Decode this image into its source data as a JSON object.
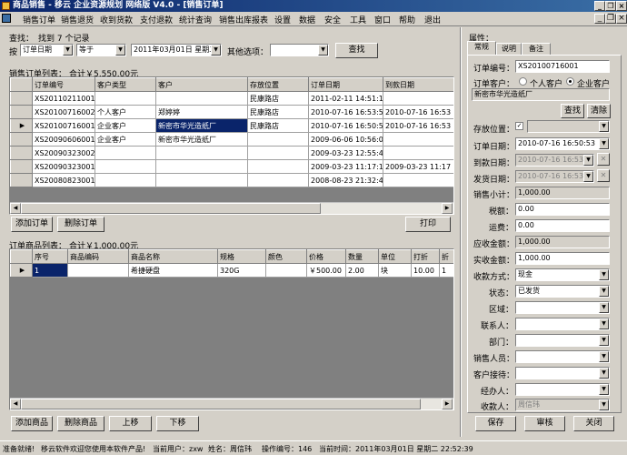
{
  "window": {
    "title": "商品销售 - 移云 企业资源规划 网络版 V4.0 - [销售订单]",
    "minimize": "_",
    "restore": "❐",
    "close": "×"
  },
  "menu": [
    "销售订单",
    "销售退货",
    "收到货款",
    "支付退款",
    "统计查询",
    "销售出库报表",
    "设置",
    "数据",
    "安全",
    "工具",
    "窗口",
    "帮助",
    "退出"
  ],
  "search": {
    "title": "查找：",
    "result": "找到 7 个记录",
    "by_label": "按",
    "field": "订单日期",
    "operator": "等于",
    "date": "2011年03月01日 星期二",
    "other_label": "其他选项：",
    "other_value": "",
    "button": "查找"
  },
  "orders": {
    "caption": "销售订单列表：",
    "total": "合计￥5,550.00元",
    "columns": [
      "订单编号",
      "客户类型",
      "客户",
      "存放位置",
      "订单日期",
      "到款日期"
    ],
    "rows": [
      {
        "marker": "",
        "id": "XS20110211001",
        "type": "",
        "customer": "",
        "location": "民康路店",
        "order_date": "2011-02-11 14:51:18",
        "pay_date": ""
      },
      {
        "marker": "",
        "id": "XS20100716002",
        "type": "个人客户",
        "customer": "郑婷婷",
        "location": "民康路店",
        "order_date": "2010-07-16 16:53:53",
        "pay_date": "2010-07-16 16:53"
      },
      {
        "marker": "▶",
        "id": "XS20100716001",
        "type": "企业客户",
        "customer": "新密市华光造纸厂",
        "location": "民康路店",
        "order_date": "2010-07-16 16:50:53",
        "pay_date": "2010-07-16 16:53"
      },
      {
        "marker": "",
        "id": "XS20090606001",
        "type": "企业客户",
        "customer": "新密市华光造纸厂",
        "location": "",
        "order_date": "2009-06-06 10:56:05",
        "pay_date": ""
      },
      {
        "marker": "",
        "id": "XS20090323002",
        "type": "",
        "customer": "",
        "location": "",
        "order_date": "2009-03-23 12:55:42",
        "pay_date": ""
      },
      {
        "marker": "",
        "id": "XS20090323001",
        "type": "",
        "customer": "",
        "location": "",
        "order_date": "2009-03-23 11:17:16",
        "pay_date": "2009-03-23 11:17"
      },
      {
        "marker": "",
        "id": "XS20080823001",
        "type": "",
        "customer": "",
        "location": "",
        "order_date": "2008-08-23 21:32:40",
        "pay_date": ""
      }
    ],
    "add_button": "添加订单",
    "delete_button": "删除订单",
    "print_button": "打印"
  },
  "items": {
    "caption": "订单商品列表：",
    "total": "合计￥1,000.00元",
    "columns": [
      "序号",
      "商品编码",
      "商品名称",
      "规格",
      "颜色",
      "价格",
      "数量",
      "单位",
      "打折",
      "折"
    ],
    "rows": [
      {
        "marker": "▶",
        "no": "1",
        "code": "",
        "name": "希捷硬盘",
        "spec": "320G",
        "color": "",
        "price": "￥500.00",
        "qty": "2.00",
        "unit": "块",
        "discount": "10.00",
        "extra": "1"
      }
    ],
    "add_button": "添加商品",
    "delete_button": "删除商品",
    "up_button": "上移",
    "down_button": "下移"
  },
  "props": {
    "title": "属性：",
    "tabs": [
      "常规",
      "说明",
      "备注"
    ],
    "order_no_label": "订单编号：",
    "order_no": "XS20100716001",
    "customer_label": "订单客户：",
    "customer_type_personal": "个人客户",
    "customer_type_company": "企业客户",
    "customer_name": "新密市华光造纸厂",
    "find_button": "查找",
    "clear_button": "清除",
    "location_label": "存放位置：",
    "location_check": "✓",
    "order_date_label": "订单日期：",
    "order_date": "2010-07-16 16:50:53",
    "pay_date_label": "到款日期：",
    "pay_date": "2010-07-16 16:53:0",
    "ship_date_label": "发货日期：",
    "ship_date": "2010-07-16 16:53:0",
    "subtotal_label": "销售小计：",
    "subtotal": "1,000.00",
    "tax_label": "税额：",
    "tax": "0.00",
    "freight_label": "运费：",
    "freight": "0.00",
    "receivable_label": "应收金额：",
    "receivable": "1,000.00",
    "received_label": "实收金额：",
    "received": "1,000.00",
    "pay_method_label": "收款方式：",
    "pay_method": "现金",
    "status_label": "状态：",
    "status": "已发货",
    "region_label": "区域：",
    "contact_label": "联系人：",
    "dept_label": "部门：",
    "salesman_label": "销售人员：",
    "reception_label": "客户接待：",
    "handler_label": "经办人：",
    "cashier_label": "收款人：",
    "cashier": "周信玮",
    "save_button": "保存",
    "audit_button": "审核",
    "close_button": "关闭"
  },
  "status": {
    "ready": "准备就绪!",
    "welcome": "移云软件欢迎您使用本软件产品!",
    "user": "当前用户：zxw",
    "name": "姓名：周信玮",
    "op_no": "操作编号：146",
    "time": "当前时间：2011年03月01日 星期二 22:52:39"
  }
}
